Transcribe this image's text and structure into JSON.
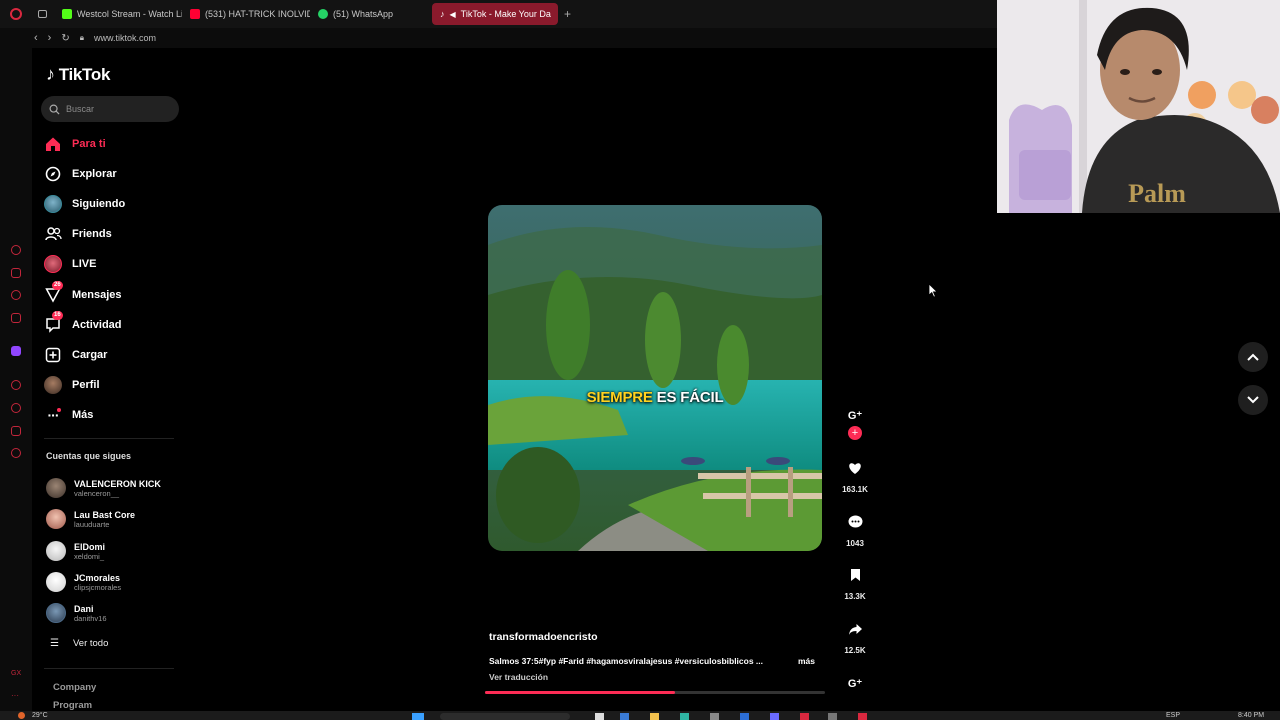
{
  "browser": {
    "tabs": [
      {
        "label": "Westcol Stream - Watch Li",
        "color": "#53fc18"
      },
      {
        "label": "(531) HAT-TRICK INOLVID",
        "color": "#ff0033"
      },
      {
        "label": "(51) WhatsApp",
        "color": "#25d366"
      },
      {
        "label": "TikTok - Make Your Da",
        "color": "#ffffff",
        "active": true
      }
    ],
    "new_tab": "+",
    "url": "www.tiktok.com"
  },
  "sidebar": {
    "logo_text": "TikTok",
    "search_placeholder": "Buscar",
    "nav": [
      {
        "label": "Para ti",
        "icon": "home-icon",
        "active": true
      },
      {
        "label": "Explorar",
        "icon": "compass-icon"
      },
      {
        "label": "Siguiendo",
        "icon": "following-avatar"
      },
      {
        "label": "Friends",
        "icon": "friends-icon"
      },
      {
        "label": "LIVE",
        "icon": "live-avatar"
      },
      {
        "label": "Mensajes",
        "icon": "messages-icon",
        "badge": "26"
      },
      {
        "label": "Actividad",
        "icon": "activity-icon",
        "badge": "16"
      },
      {
        "label": "Cargar",
        "icon": "upload-icon"
      },
      {
        "label": "Perfil",
        "icon": "profile-avatar"
      },
      {
        "label": "Más",
        "icon": "more-icon"
      }
    ],
    "following_title": "Cuentas que sigues",
    "accounts": [
      {
        "name": "VALENCERON KICK",
        "handle": "valenceron__",
        "color": "#6b5a4e"
      },
      {
        "name": "Lau Bast Core",
        "handle": "lauuduarte",
        "color": "#c98a7a"
      },
      {
        "name": "ElDomi",
        "handle": "xeldomi_",
        "color": "#d9d9d9"
      },
      {
        "name": "JCmorales",
        "handle": "clipsjcmorales",
        "color": "#f2f2f2"
      },
      {
        "name": "Dani",
        "handle": "danithv16",
        "color": "#4a6a8a"
      }
    ],
    "see_all": "Ver todo",
    "footer": [
      "Company",
      "Program"
    ]
  },
  "video": {
    "caption_highlight": "SIEMPRE",
    "caption_rest": " ES FÁCIL",
    "username": "transformadoencristo",
    "description": "Salmos 37:5#fyp #Farid #hagamosviralajesus #versiculosbiblicos ...",
    "more": "más",
    "translate": "Ver traducción",
    "progress": 0.56
  },
  "actions": {
    "likes": "163.1K",
    "comments": "1043",
    "saves": "13.3K",
    "shares": "12.5K"
  },
  "taskbar": {
    "weather": "29°C",
    "lang": "ESP",
    "time": "8:40 PM"
  },
  "colors": {
    "accent": "#fe2c55",
    "background": "#000000"
  }
}
